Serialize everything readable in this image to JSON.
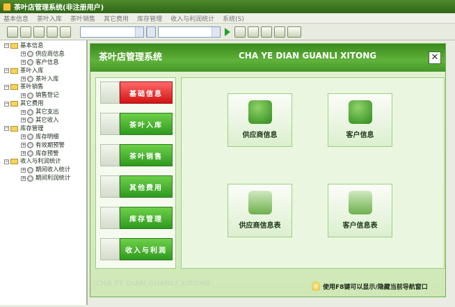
{
  "window": {
    "title": "茶叶店管理系统(非注册用户)"
  },
  "menu": [
    "基本信息",
    "茶叶入库",
    "茶叶销售",
    "其它费用",
    "库存管理",
    "收入与利润统计",
    "系统(S)"
  ],
  "toolbar": {
    "icons": [
      "tree-icon",
      "grid-icon",
      "doc-icon",
      "image-icon",
      "monitor-icon"
    ],
    "right_icons": [
      "user-search-icon",
      "zoom-icon",
      "preview-icon",
      "refresh-icon",
      "pencil-icon"
    ]
  },
  "tree": [
    {
      "label": "基本信息",
      "level": 0,
      "type": "folder"
    },
    {
      "label": "供应商信息",
      "level": 1,
      "type": "leaf"
    },
    {
      "label": "客户信息",
      "level": 1,
      "type": "leaf"
    },
    {
      "label": "茶叶入库",
      "level": 0,
      "type": "folder"
    },
    {
      "label": "茶叶入库",
      "level": 1,
      "type": "leaf"
    },
    {
      "label": "茶叶销售",
      "level": 0,
      "type": "folder"
    },
    {
      "label": "销售登记",
      "level": 1,
      "type": "leaf"
    },
    {
      "label": "其它费用",
      "level": 0,
      "type": "folder"
    },
    {
      "label": "其它支出",
      "level": 1,
      "type": "leaf"
    },
    {
      "label": "其它收入",
      "level": 1,
      "type": "leaf"
    },
    {
      "label": "库存管理",
      "level": 0,
      "type": "folder"
    },
    {
      "label": "库存明细",
      "level": 1,
      "type": "leaf"
    },
    {
      "label": "有效期预警",
      "level": 1,
      "type": "leaf"
    },
    {
      "label": "库存预警",
      "level": 1,
      "type": "leaf"
    },
    {
      "label": "收入与利润统计",
      "level": 0,
      "type": "folder"
    },
    {
      "label": "期间收入统计",
      "level": 1,
      "type": "leaf"
    },
    {
      "label": "期间利润统计",
      "level": 1,
      "type": "leaf"
    }
  ],
  "panel": {
    "title": "茶叶店管理系统",
    "title_pinyin": "CHA YE DIAN GUANLI XITONG",
    "footer_text": "CHA YE DIAN GUANLI XITONG",
    "hint": "使用F8键可以显示/隐藏当前导航窗口"
  },
  "categories": [
    {
      "label": "基础信息",
      "icon": "gear-icon",
      "active": true
    },
    {
      "label": "茶叶入库",
      "icon": "house-icon",
      "active": false
    },
    {
      "label": "茶叶销售",
      "icon": "arrow-icon",
      "active": false
    },
    {
      "label": "其他费用",
      "icon": "star-icon",
      "active": false
    },
    {
      "label": "库存管理",
      "icon": "alert-icon",
      "active": false
    },
    {
      "label": "收入与利润",
      "icon": "chart-icon",
      "active": false
    }
  ],
  "tiles": [
    {
      "label": "供应商信息",
      "icon": "supplier-icon"
    },
    {
      "label": "客户信息",
      "icon": "customer-icon"
    },
    {
      "label": "供应商信息表",
      "icon": "supplier-table-icon"
    },
    {
      "label": "客户信息表",
      "icon": "customer-table-icon"
    }
  ],
  "colors": {
    "accent": "#3a8a1c",
    "active": "#d21313",
    "button": "#2f9a1f"
  }
}
